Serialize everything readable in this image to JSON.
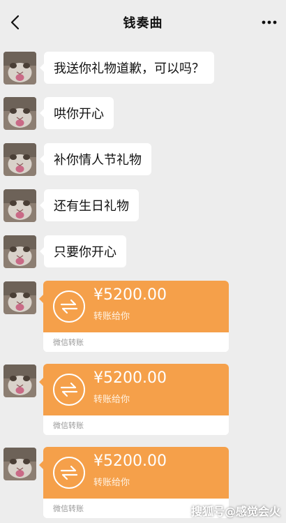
{
  "header": {
    "title": "钱奏曲",
    "back_icon": "chevron-left-icon",
    "more_icon": "more-dots-icon"
  },
  "messages": [
    {
      "type": "text",
      "text": "我送你礼物道歉，可以吗？"
    },
    {
      "type": "text",
      "text": "哄你开心"
    },
    {
      "type": "text",
      "text": "补你情人节礼物"
    },
    {
      "type": "text",
      "text": "还有生日礼物"
    },
    {
      "type": "text",
      "text": "只要你开心"
    },
    {
      "type": "transfer",
      "amount": "¥5200.00",
      "note": "转账给你",
      "footer": "微信转账"
    },
    {
      "type": "transfer",
      "amount": "¥5200.00",
      "note": "转账给你",
      "footer": "微信转账"
    },
    {
      "type": "transfer",
      "amount": "¥5200.00",
      "note": "转账给你",
      "footer": "微信转账"
    }
  ],
  "watermark": "搜狐号@感觉会火",
  "colors": {
    "background": "#ededed",
    "bubble": "#ffffff",
    "transfer": "#f5a04a"
  }
}
